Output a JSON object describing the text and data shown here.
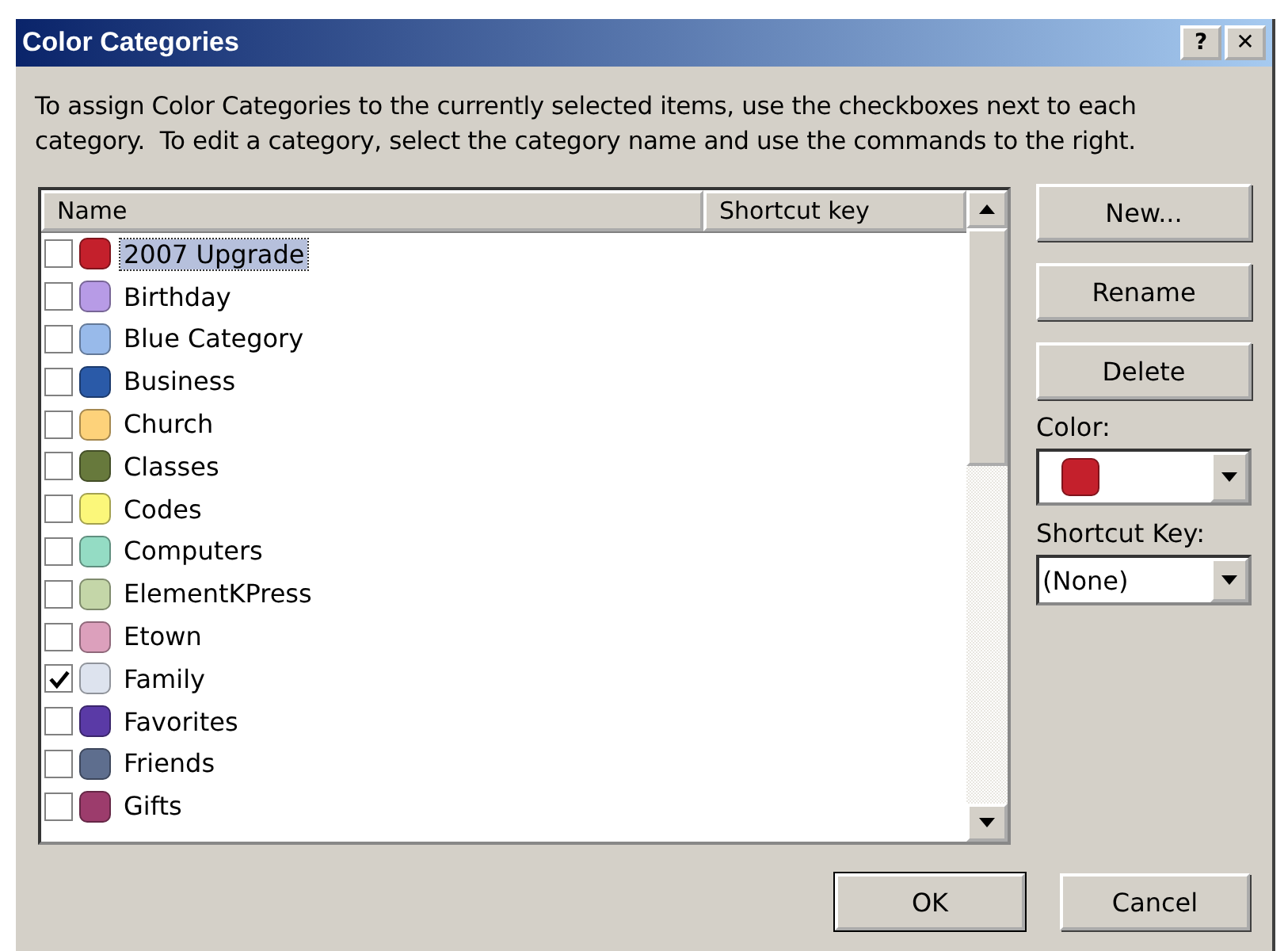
{
  "window": {
    "title": "Color Categories",
    "help_button": "?",
    "close_button": "✕"
  },
  "instructions": "To assign Color Categories to the currently selected items, use the checkboxes next to each category.  To edit a category, select the category name and use the commands to the right.",
  "list": {
    "columns": [
      "Name",
      "Shortcut key"
    ],
    "items": [
      {
        "name": "2007 Upgrade",
        "color": "#c4202c",
        "checked": false,
        "selected": true
      },
      {
        "name": "Birthday",
        "color": "#b79be6",
        "checked": false,
        "selected": false
      },
      {
        "name": "Blue Category",
        "color": "#98baea",
        "checked": false,
        "selected": false
      },
      {
        "name": "Business",
        "color": "#2a5aa8",
        "checked": false,
        "selected": false
      },
      {
        "name": "Church",
        "color": "#fdd27a",
        "checked": false,
        "selected": false
      },
      {
        "name": "Classes",
        "color": "#67793c",
        "checked": false,
        "selected": false
      },
      {
        "name": "Codes",
        "color": "#fbf77a",
        "checked": false,
        "selected": false
      },
      {
        "name": "Computers",
        "color": "#94dcc4",
        "checked": false,
        "selected": false
      },
      {
        "name": "ElementKPress",
        "color": "#c4d6a8",
        "checked": false,
        "selected": false
      },
      {
        "name": "Etown",
        "color": "#dca0bc",
        "checked": false,
        "selected": false
      },
      {
        "name": "Family",
        "color": "#dde3ee",
        "checked": true,
        "selected": false
      },
      {
        "name": "Favorites",
        "color": "#5a3aa6",
        "checked": false,
        "selected": false
      },
      {
        "name": "Friends",
        "color": "#5e6e8e",
        "checked": false,
        "selected": false
      },
      {
        "name": "Gifts",
        "color": "#9c3c6c",
        "checked": false,
        "selected": false
      }
    ]
  },
  "side_buttons": [
    "New...",
    "Rename",
    "Delete"
  ],
  "color_field": {
    "label": "Color:",
    "color": "#c4202c"
  },
  "shortcut_field": {
    "label": "Shortcut Key:",
    "value": "(None)"
  },
  "buttons": [
    {
      "label": "OK",
      "default": true
    },
    {
      "label": "Cancel",
      "default": false
    }
  ]
}
